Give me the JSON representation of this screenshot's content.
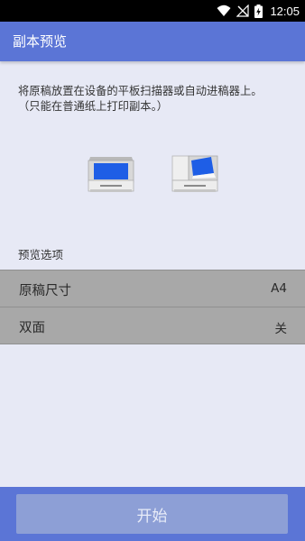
{
  "status_bar": {
    "time": "12:05",
    "icons": [
      "wifi-icon",
      "signal-off-icon",
      "battery-charging-icon"
    ]
  },
  "app_bar": {
    "title": "副本预览"
  },
  "instructions": {
    "line1": "将原稿放置在设备的平板扫描器或自动进稿器上。",
    "line2": "（只能在普通纸上打印副本。）"
  },
  "illustrations": [
    "flatbed-scanner-icon",
    "document-feeder-icon"
  ],
  "preview_options": {
    "section_label": "预览选项",
    "items": [
      {
        "label": "原稿尺寸",
        "value": "A4"
      },
      {
        "label": "双面",
        "value": "关"
      }
    ]
  },
  "start_button": {
    "label": "开始"
  },
  "colors": {
    "accent": "#5b75d6",
    "background": "#e7e9f5",
    "option_row": "#a8a8a8",
    "start_button_disabled": "#8d9fd6",
    "scanner_screen": "#1e5ee6"
  }
}
